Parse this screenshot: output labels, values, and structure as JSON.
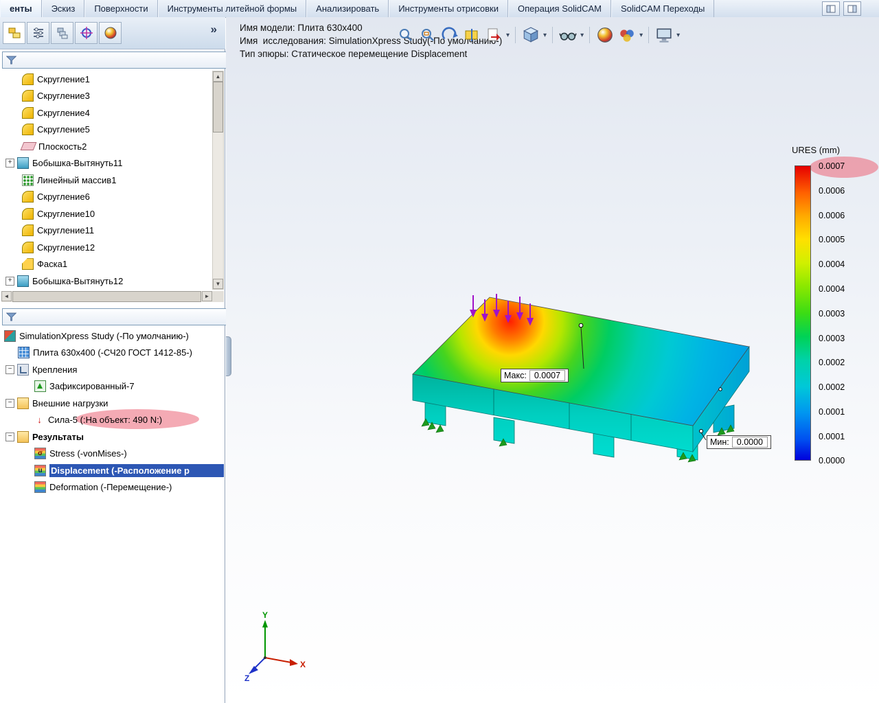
{
  "menubar": {
    "tabs": [
      "енты",
      "Эскиз",
      "Поверхности",
      "Инструменты литейной формы",
      "Анализировать",
      "Инструменты отрисовки",
      "Операция  SolidCAM",
      "SolidCAM Переходы"
    ]
  },
  "left_panel": {
    "chevron": "»",
    "scroll": {
      "up": "▲",
      "down": "▼",
      "left": "◄",
      "right": "►"
    },
    "feature_tree": {
      "items": [
        {
          "label": "Скругление1",
          "icon": "fillet"
        },
        {
          "label": "Скругление3",
          "icon": "fillet"
        },
        {
          "label": "Скругление4",
          "icon": "fillet"
        },
        {
          "label": "Скругление5",
          "icon": "fillet"
        },
        {
          "label": "Плоскость2",
          "icon": "plane"
        },
        {
          "label": "Бобышка-Вытянуть11",
          "icon": "boss-extrude"
        },
        {
          "label": "Линейный массив1",
          "icon": "linear-pattern"
        },
        {
          "label": "Скругление6",
          "icon": "fillet"
        },
        {
          "label": "Скругление10",
          "icon": "fillet"
        },
        {
          "label": "Скругление11",
          "icon": "fillet"
        },
        {
          "label": "Скругление12",
          "icon": "fillet"
        },
        {
          "label": "Фаска1",
          "icon": "chamfer"
        },
        {
          "label": "Бобышка-Вытянуть12",
          "icon": "boss-extrude"
        }
      ]
    },
    "sim_tree": {
      "items": [
        {
          "label": "SimulationXpress Study (-По умолчанию-)",
          "icon": "study"
        },
        {
          "label": "Плита 630x400 (-СЧ20 ГОСТ 1412-85-)",
          "icon": "mesh-part"
        },
        {
          "label": "Крепления",
          "icon": "fixtures-folder"
        },
        {
          "label": "Зафиксированный-7",
          "icon": "fixture"
        },
        {
          "label": "Внешние нагрузки",
          "icon": "loads-folder"
        },
        {
          "label": "Сила-5 (:На объект: 490 N:)",
          "icon": "force"
        },
        {
          "label": "Результаты",
          "icon": "results-folder"
        },
        {
          "label": "Stress (-vonMises-)",
          "icon": "stress-plot"
        },
        {
          "label": "Displacement (-Расположение р",
          "icon": "displacement-plot"
        },
        {
          "label": "Deformation (-Перемещение-)",
          "icon": "deformation-plot"
        }
      ]
    }
  },
  "expanders": {
    "plus": "+",
    "minus": "−"
  },
  "icon_glyphs": {
    "force": "↓",
    "stress": "σ",
    "displacement": "u"
  },
  "viewport": {
    "info": {
      "line1": "Имя модели: Плита 630x400",
      "line2": "Имя  исследования: SimulationXpress Study(-По умолчанию-)",
      "line3": "Тип эпюры: Статическое перемещение Displacement"
    },
    "callout_max": {
      "label": "Макс:",
      "value": "0.0007"
    },
    "callout_min": {
      "label": "Мин:",
      "value": "0.0000"
    },
    "triad": {
      "x": "X",
      "y": "Y",
      "z": "Z"
    }
  },
  "legend": {
    "title": "URES (mm)",
    "ticks": [
      "0.0007",
      "0.0006",
      "0.0006",
      "0.0005",
      "0.0004",
      "0.0004",
      "0.0003",
      "0.0003",
      "0.0002",
      "0.0002",
      "0.0001",
      "0.0001",
      "0.0000"
    ]
  }
}
